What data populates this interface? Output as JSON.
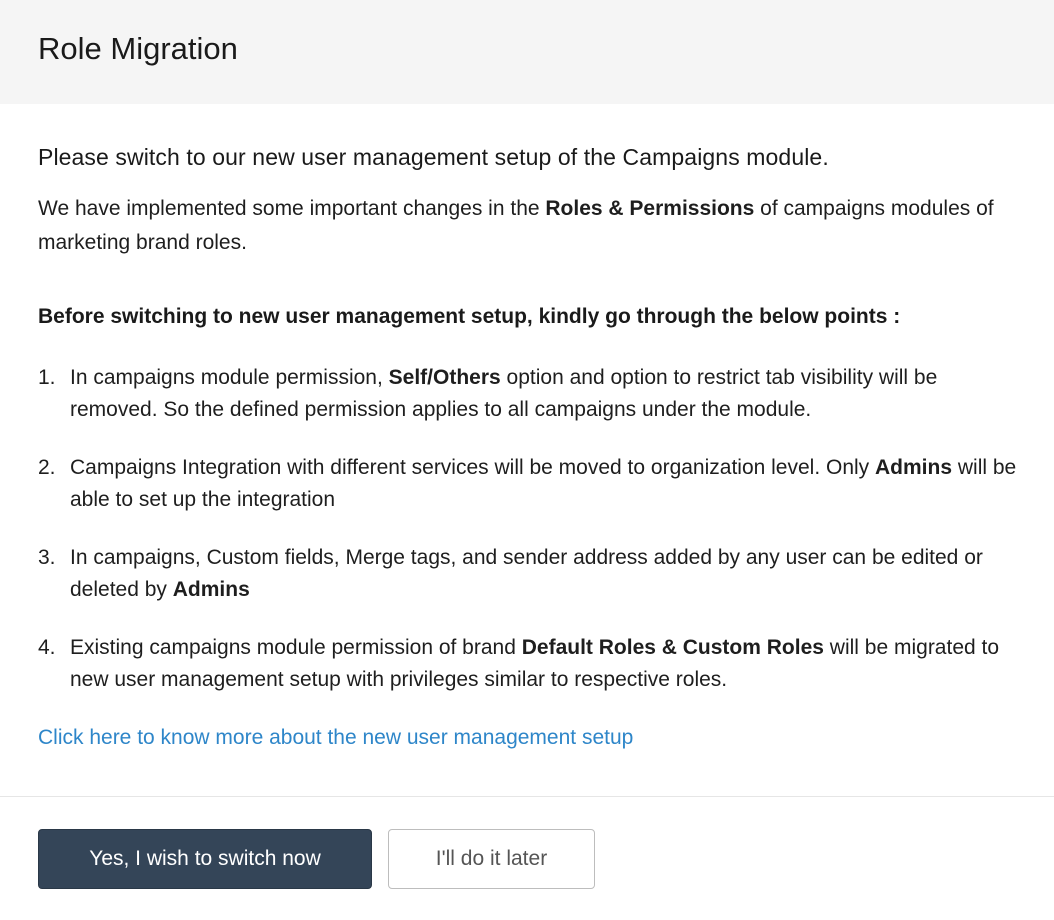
{
  "dialog": {
    "title": "Role Migration",
    "intro_heading": "Please switch to our new user management setup of the Campaigns module.",
    "intro": {
      "before": "We have implemented some important changes in the ",
      "bold": "Roles & Permissions",
      "after": " of campaigns modules of marketing brand roles."
    },
    "points_heading": "Before switching to new user management setup, kindly go through the below points :",
    "points": [
      {
        "num": "1.",
        "before": "In campaigns module permission, ",
        "bold": "Self/Others",
        "after": " option and option to restrict tab visibility will be removed. So the defined permission applies to all campaigns under the module."
      },
      {
        "num": "2.",
        "before": "Campaigns Integration with different services will be moved to organization level. Only ",
        "bold": "Admins",
        "after": " will be able to set up the integration"
      },
      {
        "num": "3.",
        "before": "In campaigns, Custom fields, Merge tags, and sender address added by any user can be edited or deleted by ",
        "bold": "Admins",
        "after": ""
      },
      {
        "num": "4.",
        "before": "Existing campaigns module permission of brand ",
        "bold": "Default Roles & Custom Roles",
        "after": " will be migrated to new user management setup with privileges similar to respective roles."
      }
    ],
    "learn_more_link": "Click here to know more about the new user management setup",
    "primary_button": "Yes, I wish to switch now",
    "secondary_button": "I'll do it later",
    "colors": {
      "primary_button_bg": "#344558",
      "link": "#2e86c9",
      "header_bg": "#f5f5f5"
    }
  }
}
